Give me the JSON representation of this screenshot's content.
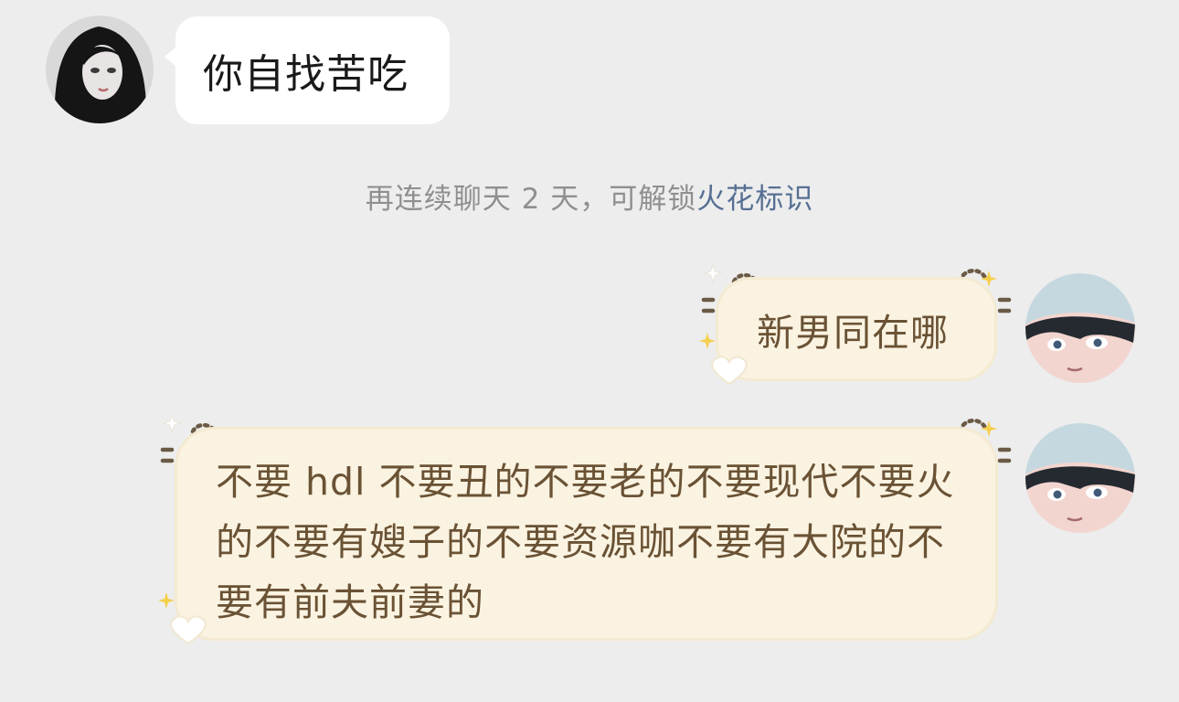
{
  "messages": [
    {
      "direction": "incoming",
      "text": "你自找苦吃"
    },
    {
      "direction": "outgoing",
      "text": "新男同在哪"
    },
    {
      "direction": "outgoing",
      "text": "不要 hdl 不要丑的不要老的不要现代不要火的不要有嫂子的不要资源咖不要有大院的不要有前夫前妻的"
    }
  ],
  "notice": {
    "prefix": "再连续聊天 2 天，可解锁",
    "link": "火花标识"
  },
  "colors": {
    "background": "#ededed",
    "incoming_bubble": "#ffffff",
    "outgoing_bubble": "#fbf3e1",
    "outgoing_text": "#6a5235",
    "notice_text": "#8f8f8f",
    "notice_link": "#566f93"
  },
  "icons": [
    "contact-avatar",
    "self-avatar",
    "sparkle-icon",
    "heart-icon",
    "ear-deco"
  ]
}
